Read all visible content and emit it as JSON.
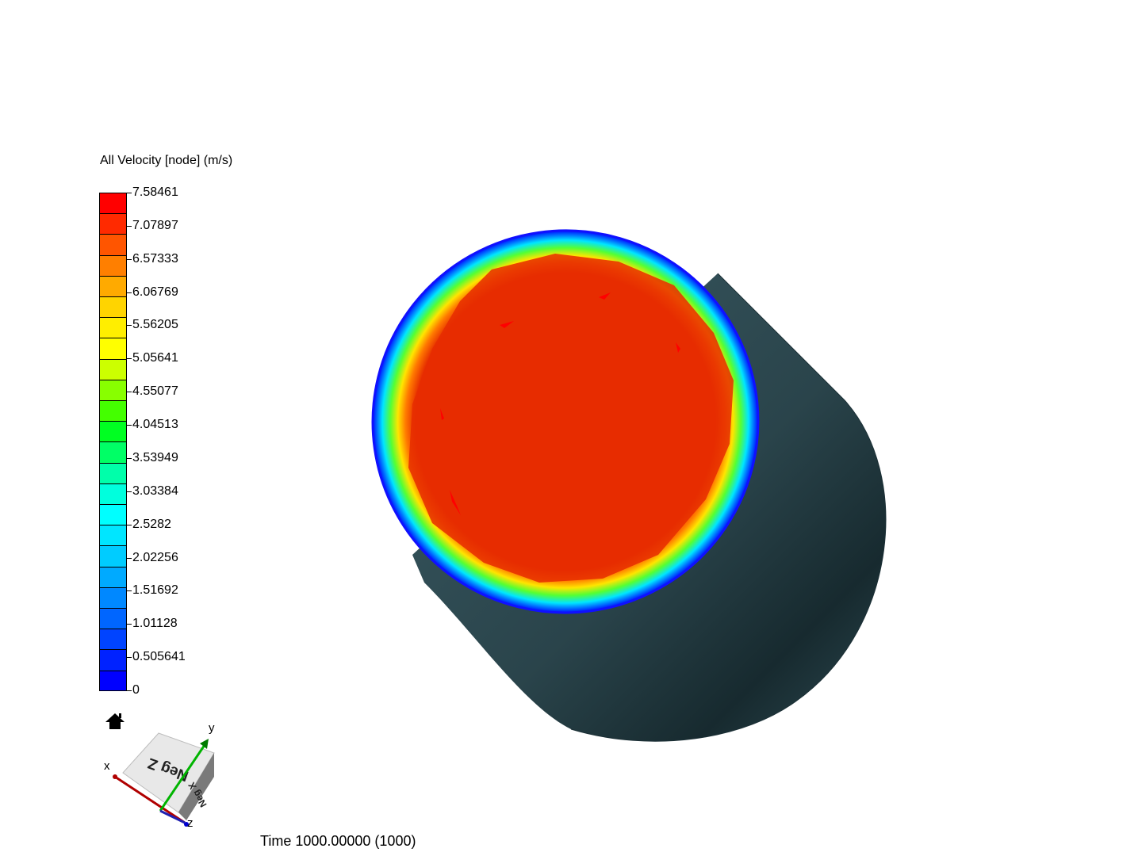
{
  "legend": {
    "title": "All Velocity [node] (m/s)",
    "labels": [
      "7.58461",
      "7.07897",
      "6.57333",
      "6.06769",
      "5.56205",
      "5.05641",
      "4.55077",
      "4.04513",
      "3.53949",
      "3.03384",
      "2.5282",
      "2.02256",
      "1.51692",
      "1.01128",
      "0.505641",
      "0"
    ],
    "swatch_colors": [
      "#ff0000",
      "#ff2a00",
      "#ff5500",
      "#ff7f00",
      "#ffaa00",
      "#ffd400",
      "#ffee00",
      "#ffff00",
      "#ccff00",
      "#88ff00",
      "#44ff00",
      "#00ff22",
      "#00ff66",
      "#00ffaa",
      "#00ffdd",
      "#00ffff",
      "#00e6ff",
      "#00ccff",
      "#00aaff",
      "#0088ff",
      "#0066ff",
      "#0044ff",
      "#0022ff",
      "#0000ff"
    ],
    "min": 0,
    "max": 7.58461
  },
  "orientation": {
    "cube_face_top": "Neg Z",
    "cube_face_side": "Neg X",
    "axis_x": "x",
    "axis_y": "y",
    "axis_z": "z"
  },
  "time_label": "Time 1000.00000 (1000)",
  "icons": {
    "home": "home-icon"
  }
}
